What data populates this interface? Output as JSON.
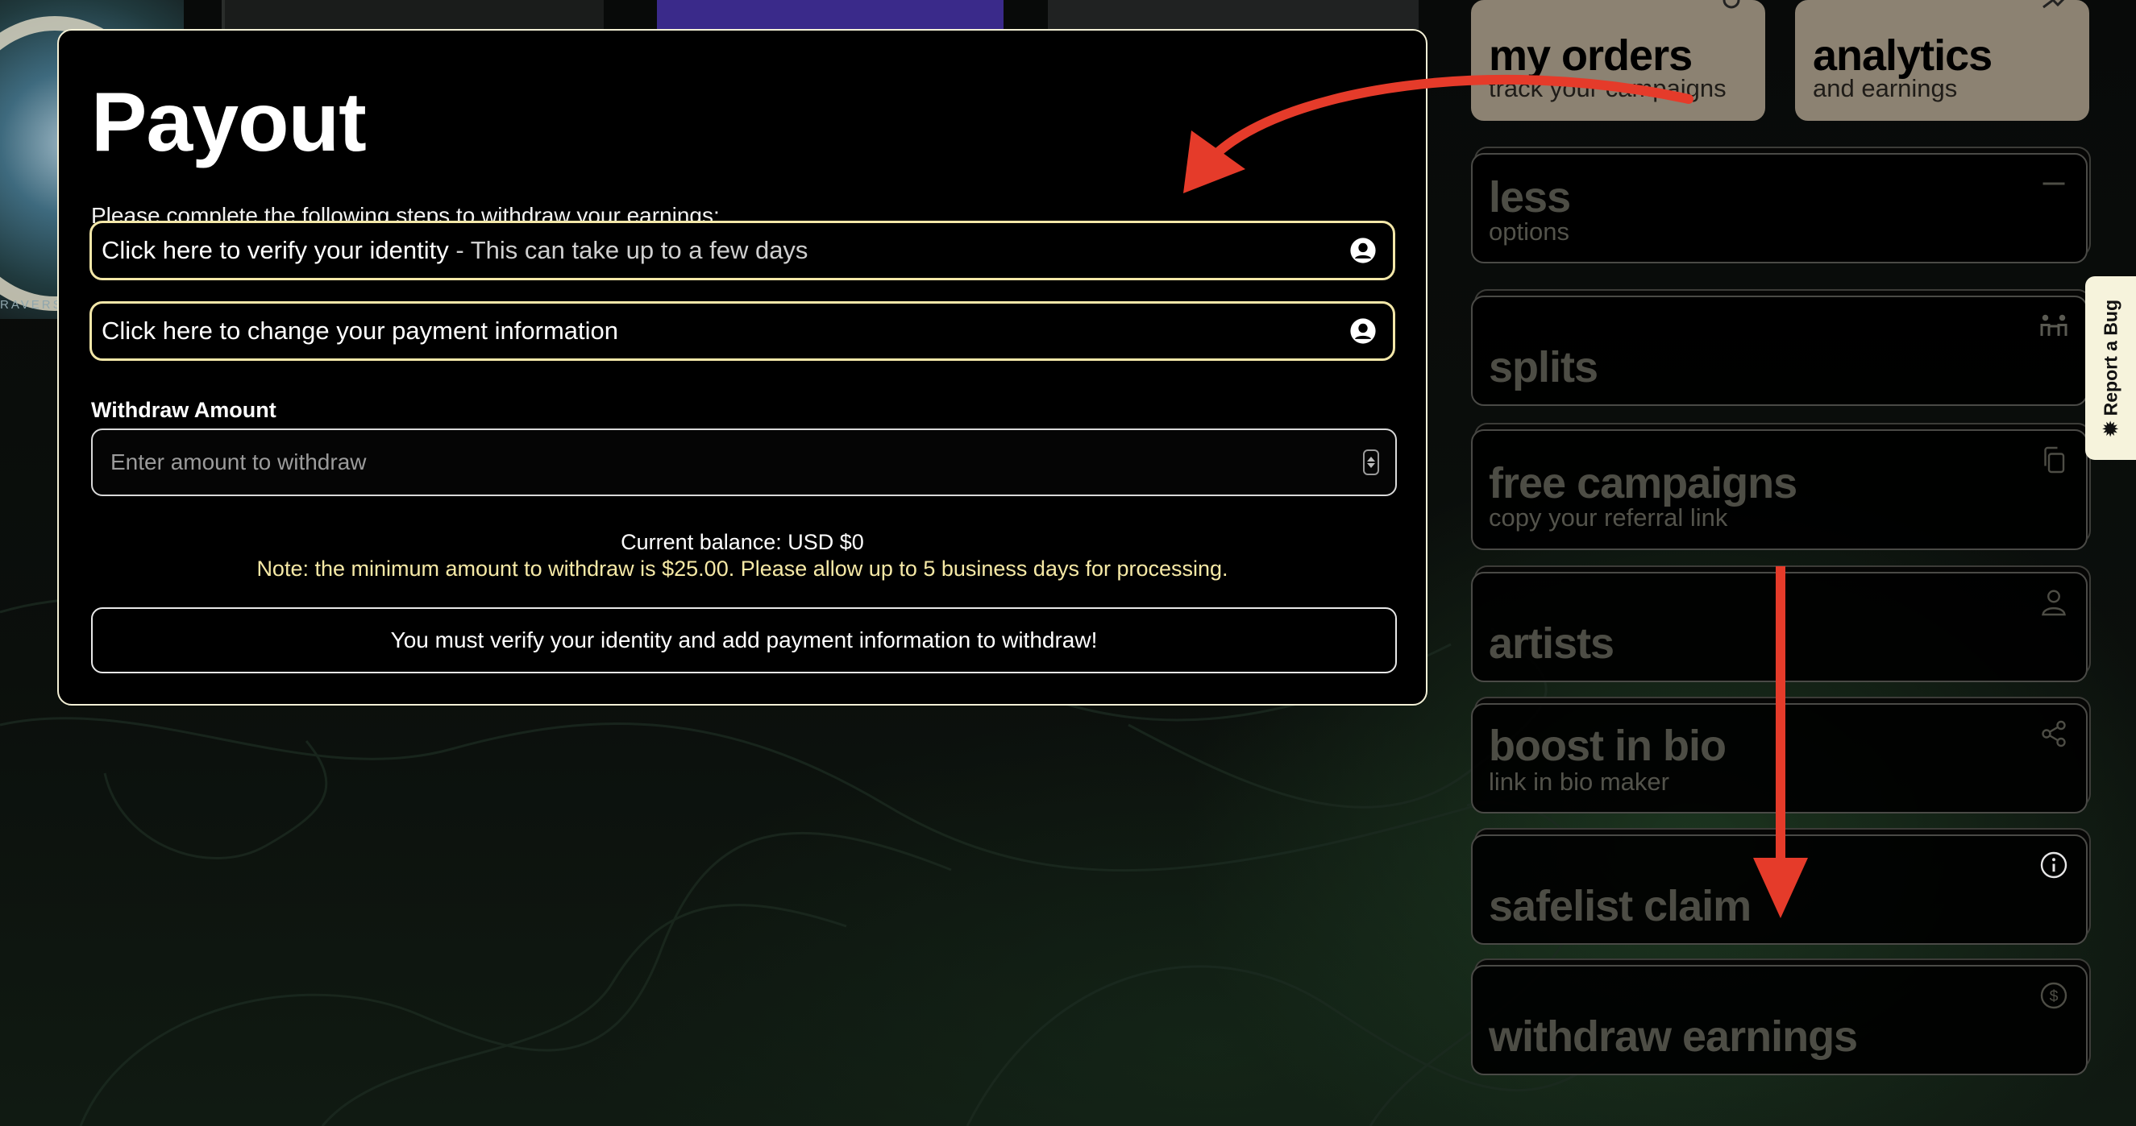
{
  "thumbnails": {
    "first_caption": "RAVERS"
  },
  "modal": {
    "title": "Payout",
    "subtitle": "Please complete the following steps to withdraw your earnings:",
    "verify_step": {
      "label": "Click here to verify your identity",
      "note": " - This can take up to a few days",
      "icon": "user-circle-icon"
    },
    "payment_step": {
      "label": "Click here to change your payment information",
      "icon": "user-circle-icon"
    },
    "amount_label": "Withdraw Amount",
    "amount_placeholder": "Enter amount to withdraw",
    "amount_value": "",
    "balance": "Current balance: USD $0",
    "note": "Note: the minimum amount to withdraw is $25.00. Please allow up to 5 business days for processing.",
    "withdraw_button": "You must verify your identity and add payment information to withdraw!"
  },
  "menu": {
    "my_orders": {
      "title": "my orders",
      "sub": "track your campaigns",
      "icon": "orders-icon"
    },
    "analytics": {
      "title": "analytics",
      "sub": "and earnings",
      "icon": "trend-icon"
    },
    "less": {
      "title": "less",
      "sub": "options",
      "icon": "minus-icon"
    },
    "splits": {
      "title": "splits",
      "icon": "people-arrows-icon"
    },
    "free_campaigns": {
      "title": "free campaigns",
      "sub": "copy your referral link",
      "icon": "copy-icon"
    },
    "artists": {
      "title": "artists",
      "icon": "user-icon"
    },
    "boost_in_bio": {
      "title": "boost in bio",
      "sub": "link in bio maker",
      "icon": "share-icon"
    },
    "safelist_claim": {
      "title": "safelist claim",
      "icon": "info-icon"
    },
    "withdraw_earnings": {
      "title": "withdraw earnings",
      "icon": "dollar-icon"
    }
  },
  "bug_tab": {
    "label": "Report a Bug",
    "icon": "bug-icon"
  },
  "annotations": {
    "arrow_color": "#e53b2a"
  },
  "colors": {
    "modal_border": "#f3f0d6",
    "step_border": "#f3e7a8",
    "note": "#f6e9a6",
    "card_tan": "#8c8272"
  }
}
